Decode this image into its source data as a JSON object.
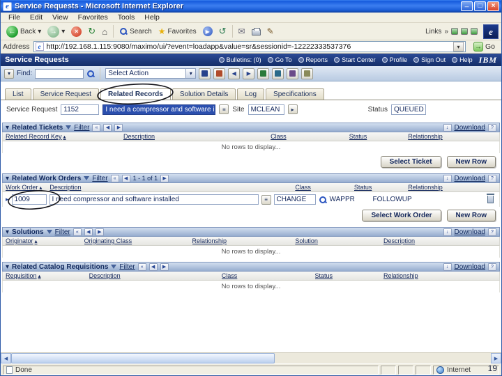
{
  "titlebar": {
    "title": "Service Requests - Microsoft Internet Explorer"
  },
  "menubar": {
    "items": [
      "File",
      "Edit",
      "View",
      "Favorites",
      "Tools",
      "Help"
    ]
  },
  "ie_toolbar": {
    "back_label": "Back",
    "search_label": "Search",
    "favorites_label": "Favorites",
    "links_label": "Links",
    "icons": [
      "back-icon",
      "forward-icon",
      "stop-icon",
      "refresh-icon",
      "home-icon",
      "search-icon",
      "favorites-icon",
      "media-icon",
      "history-icon",
      "mail-icon",
      "print-icon",
      "edit-icon",
      "links-chevron-icon",
      "ie-throbber-icon"
    ]
  },
  "addressbar": {
    "label": "Address",
    "url": "http://192.168.1.115:9080/maximo/ui/?event=loadapp&value=sr&sessionid=-12222333537376",
    "go_label": "Go"
  },
  "app_header": {
    "title": "Service Requests",
    "links": [
      {
        "label": "Bulletins: (0)"
      },
      {
        "label": "Go To"
      },
      {
        "label": "Reports"
      },
      {
        "label": "Start Center"
      },
      {
        "label": "Profile"
      },
      {
        "label": "Sign Out"
      },
      {
        "label": "Help"
      }
    ],
    "brand": "IBM"
  },
  "app_toolbar": {
    "find_label": "Find:",
    "select_action_label": "Select Action",
    "icons": [
      "save-icon",
      "clear-changes-icon",
      "previous-record-icon",
      "next-record-icon",
      "change-status-icon",
      "create-kpi-icon",
      "process-flow-icon",
      "attachments-icon"
    ]
  },
  "tabs": [
    {
      "label": "List"
    },
    {
      "label": "Service Request"
    },
    {
      "label": "Related Records",
      "selected": true
    },
    {
      "label": "Solution Details"
    },
    {
      "label": "Log"
    },
    {
      "label": "Specifications"
    }
  ],
  "fields": {
    "service_request_label": "Service Request",
    "service_request_value": "1152",
    "summary_value": "I need a compressor and software installed",
    "site_label": "Site",
    "site_value": "MCLEAN",
    "status_label": "Status",
    "status_value": "QUEUED"
  },
  "related_tickets": {
    "title": "Related Tickets",
    "filter_label": "Filter",
    "download_label": "Download",
    "columns": [
      "Related Record Key",
      "Description",
      "Class",
      "Status",
      "Relationship"
    ],
    "empty_text": "No rows to display...",
    "select_button": "Select Ticket",
    "new_row_button": "New Row"
  },
  "related_work_orders": {
    "title": "Related Work Orders",
    "filter_label": "Filter",
    "pagination": "1 - 1 of 1",
    "download_label": "Download",
    "columns": [
      "Work Order",
      "Description",
      "Class",
      "Status",
      "Relationship"
    ],
    "row": {
      "work_order": "1009",
      "description": "I need compressor and software installed",
      "class": "CHANGE",
      "status": "WAPPR",
      "relationship": "FOLLOWUP"
    },
    "select_button": "Select Work Order",
    "new_row_button": "New Row"
  },
  "solutions": {
    "title": "Solutions",
    "filter_label": "Filter",
    "download_label": "Download",
    "columns": [
      "Originator",
      "Originating Class",
      "Relationship",
      "Solution",
      "Description"
    ],
    "empty_text": "No rows to display..."
  },
  "related_catalog_requisitions": {
    "title": "Related Catalog Requisitions",
    "filter_label": "Filter",
    "download_label": "Download",
    "columns": [
      "Requisition",
      "Description",
      "Class",
      "Status",
      "Relationship"
    ],
    "empty_text": "No rows to display..."
  },
  "statusbar": {
    "left": "Done",
    "zone": "Internet"
  },
  "slide_number": "19",
  "colors": {
    "titlebar_blue": "#1c5fd8",
    "maximo_header_navy": "#142e68",
    "selection_blue": "#2b4fae",
    "section_header_from": "#d3deef",
    "section_header_to": "#97adcf"
  }
}
